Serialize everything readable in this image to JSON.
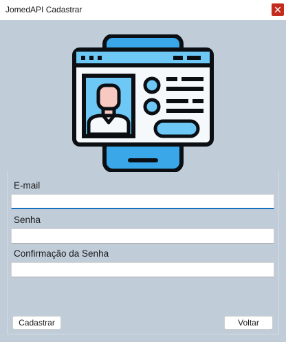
{
  "window": {
    "title": "JomedAPI Cadastrar",
    "close_icon": "close-icon",
    "colors": {
      "close_background": "#c42b1c",
      "background": "#c0ccd8"
    }
  },
  "hero": {
    "icon": "profile-card-icon",
    "colors": {
      "outline": "#0b0f14",
      "screen": "#f5f9fc",
      "accent": "#6ec8f5",
      "accent_dark": "#3aa7e8",
      "skin": "#f8c9c1"
    }
  },
  "form": {
    "email": {
      "label": "E-mail",
      "value": "",
      "placeholder": ""
    },
    "password": {
      "label": "Senha",
      "value": "",
      "placeholder": ""
    },
    "password_confirm": {
      "label": "Confirmação da Senha",
      "value": "",
      "placeholder": ""
    },
    "accent_color": "#1570c2"
  },
  "buttons": {
    "register_label": "Cadastrar",
    "back_label": "Voltar"
  }
}
